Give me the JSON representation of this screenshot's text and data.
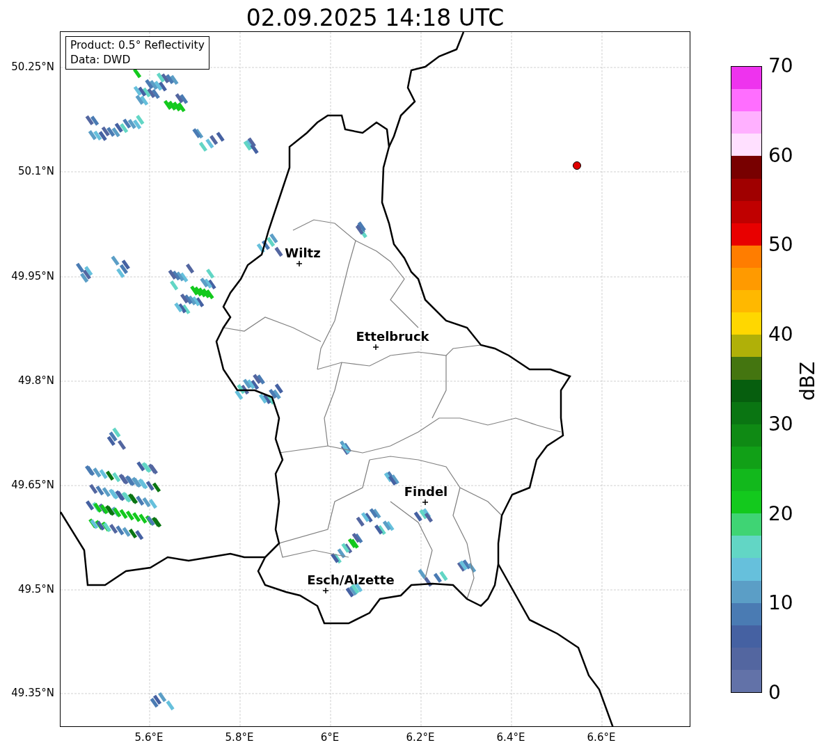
{
  "title": "02.09.2025 14:18 UTC",
  "info_box": [
    "Product: 0.5° Reflectivity",
    "Data: DWD"
  ],
  "lat_labels": [
    "50.25°N",
    "50.1°N",
    "49.95°N",
    "49.8°N",
    "49.65°N",
    "49.5°N",
    "49.35°N"
  ],
  "lon_labels": [
    "5.6°E",
    "5.8°E",
    "6°E",
    "6.2°E",
    "6.4°E",
    "6.6°E"
  ],
  "cities": [
    {
      "name": "Wiltz"
    },
    {
      "name": "Ettelbruck"
    },
    {
      "name": "Findel"
    },
    {
      "name": "Esch/Alzette"
    }
  ],
  "site_marker": {
    "color": "#e00000"
  },
  "colorbar": {
    "label": "dBZ",
    "ticks": [
      "70",
      "60",
      "50",
      "40",
      "30",
      "20",
      "10",
      "0"
    ],
    "segments": [
      {
        "color": "#ee33ee"
      },
      {
        "color": "#ff6eff"
      },
      {
        "color": "#ffb0ff"
      },
      {
        "color": "#ffe0ff"
      },
      {
        "color": "#780000"
      },
      {
        "color": "#a00000"
      },
      {
        "color": "#c00000"
      },
      {
        "color": "#e80000"
      },
      {
        "color": "#ff7d00"
      },
      {
        "color": "#ff9a00"
      },
      {
        "color": "#ffb800"
      },
      {
        "color": "#ffd700"
      },
      {
        "color": "#b0b008"
      },
      {
        "color": "#447510"
      },
      {
        "color": "#065e0e"
      },
      {
        "color": "#0a7512"
      },
      {
        "color": "#0f8a14"
      },
      {
        "color": "#11a017"
      },
      {
        "color": "#12b81c"
      },
      {
        "color": "#13c91d"
      },
      {
        "color": "#3fd474"
      },
      {
        "color": "#62d6c5"
      },
      {
        "color": "#66c0dc"
      },
      {
        "color": "#5b9ec6"
      },
      {
        "color": "#4a7bb3"
      },
      {
        "color": "#4561a2"
      },
      {
        "color": "#5366a0"
      },
      {
        "color": "#6272a8"
      }
    ]
  }
}
